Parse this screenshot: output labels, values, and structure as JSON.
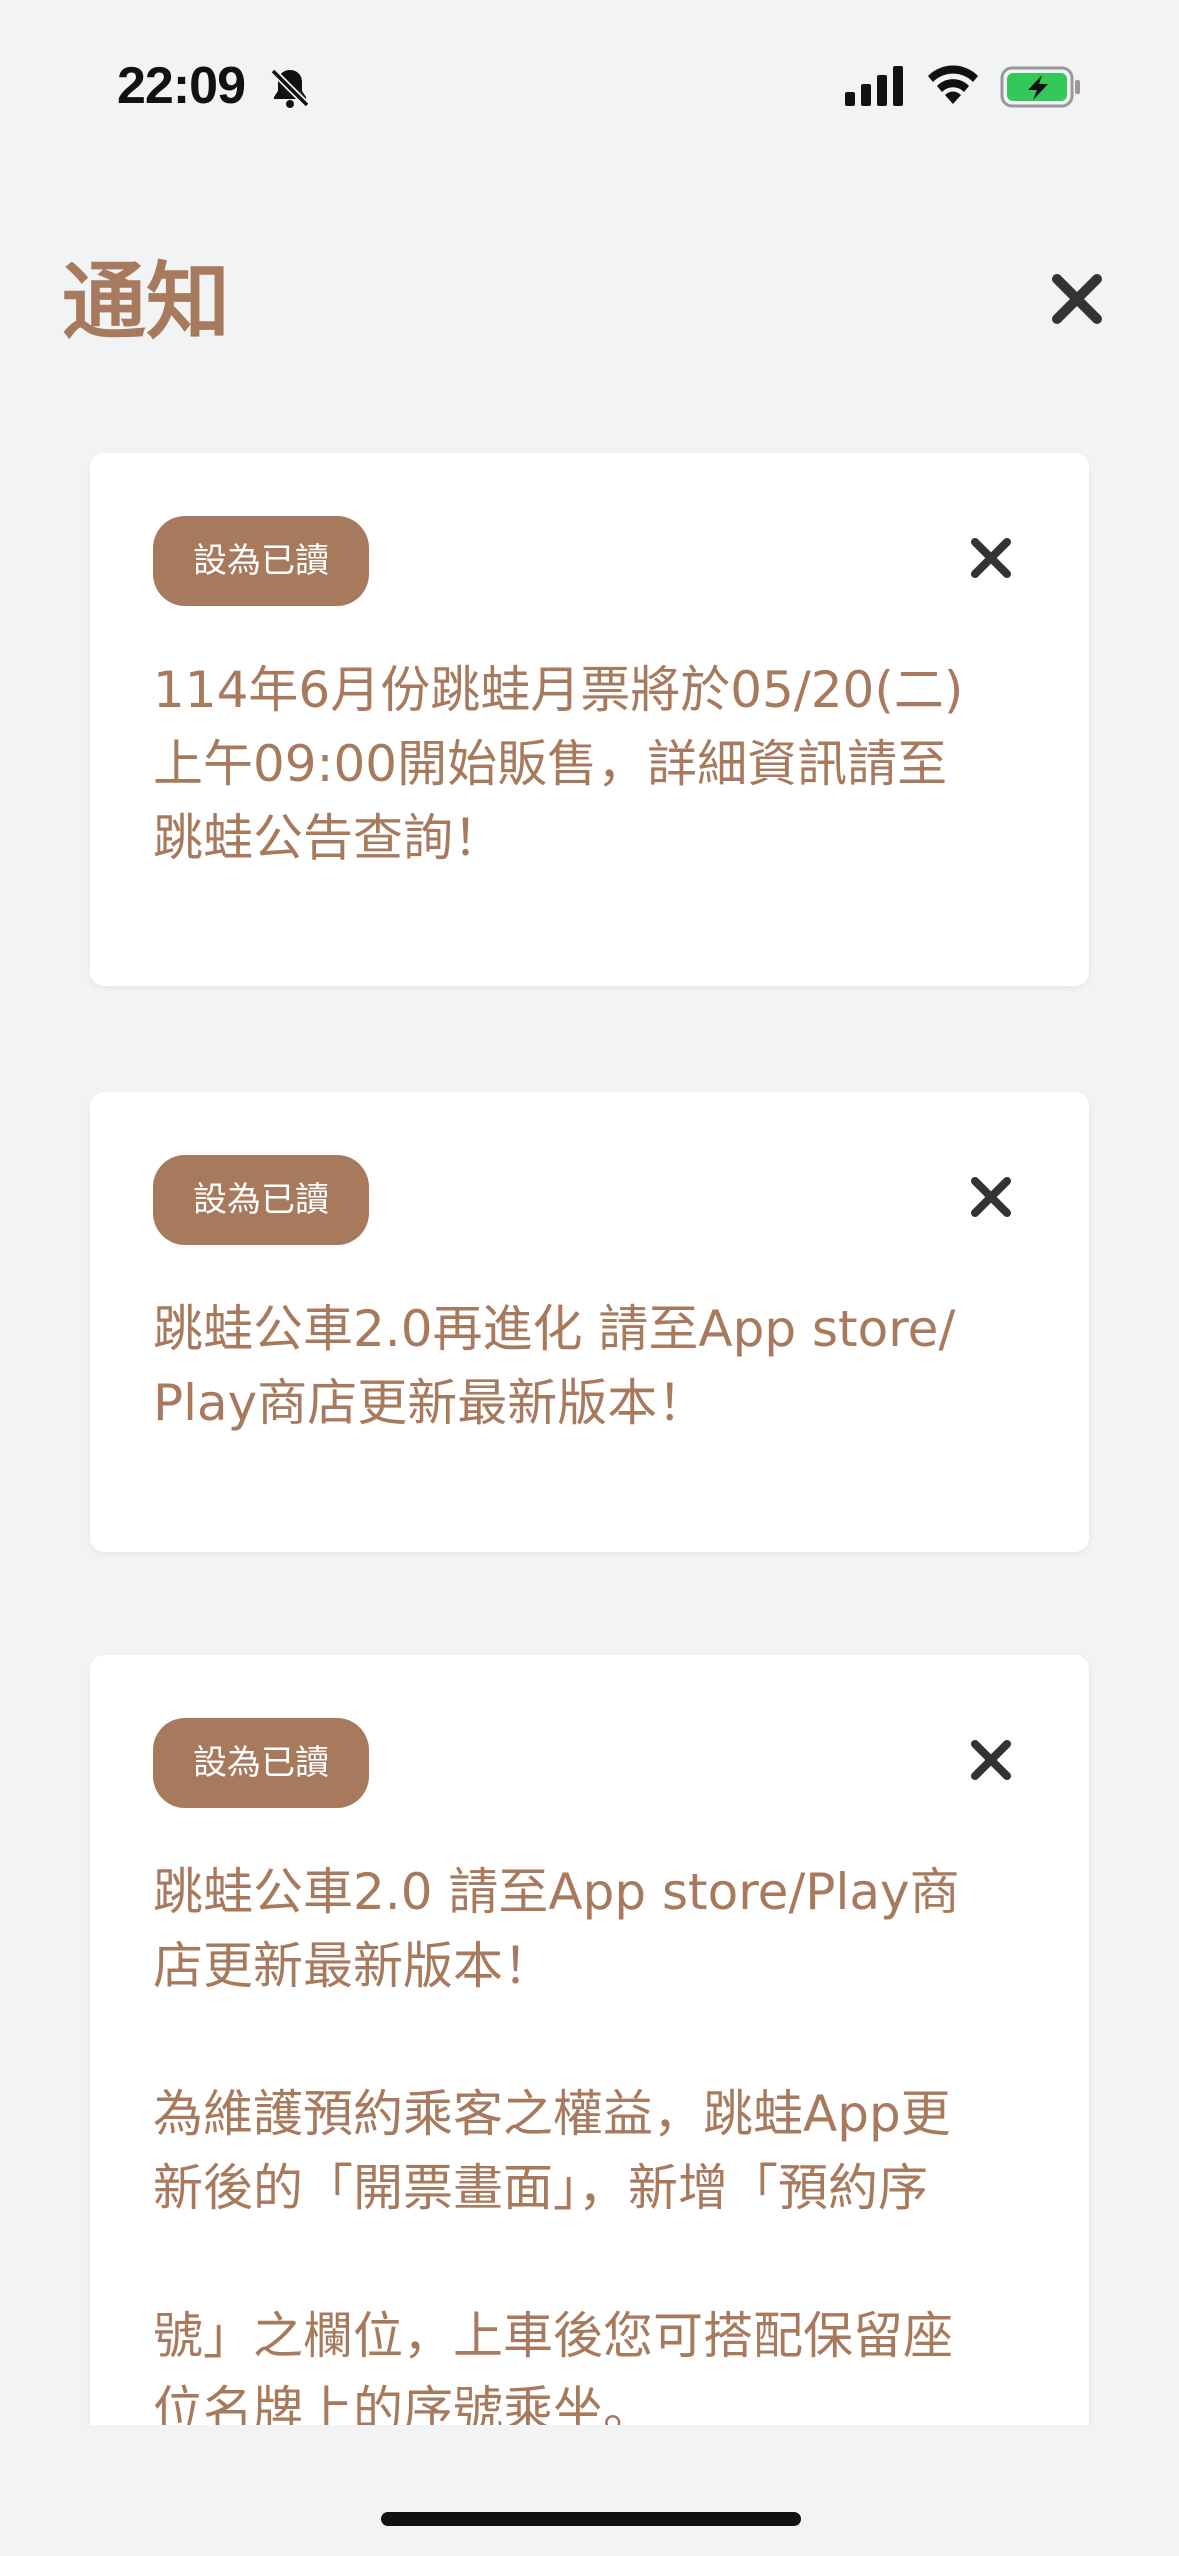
{
  "status_bar": {
    "time": "22:09",
    "icons": [
      "bell-slash-icon",
      "signal-icon",
      "wifi-icon",
      "battery-charging-icon"
    ],
    "battery_color": "#34c759"
  },
  "header": {
    "title": "通知",
    "close_icon": "close-icon"
  },
  "colors": {
    "accent": "#a87a5d",
    "background": "#f2f3f5",
    "card": "#ffffff"
  },
  "notifications": [
    {
      "button_label": "設為已讀",
      "message": "114年6月份跳蛙月票將於05/20(二)\n上午09:00開始販售，詳細資訊請至\n跳蛙公告查詢！"
    },
    {
      "button_label": "設為已讀",
      "message": "跳蛙公車2.0再進化 請至App store/\nPlay商店更新最新版本！"
    },
    {
      "button_label": "設為已讀",
      "message": "跳蛙公車2.0 請至App store/Play商\n店更新最新版本！\n\n為維護預約乘客之權益，跳蛙App更\n新後的「開票畫面」，新增「預約序\n\n號」之欄位，上車後您可搭配保留座\n位名牌上的序號乘坐。"
    }
  ]
}
